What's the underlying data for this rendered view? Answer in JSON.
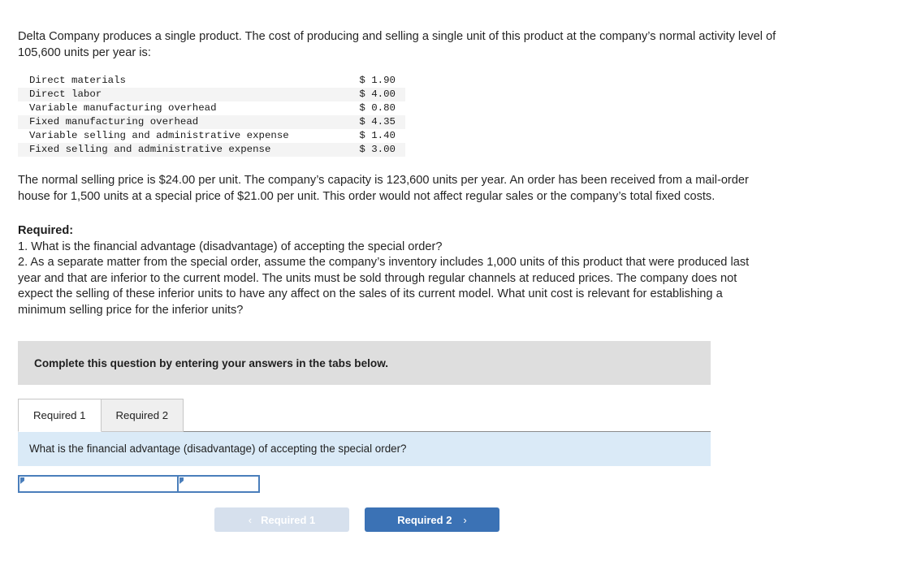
{
  "intro": {
    "paragraph": "Delta Company produces a single product. The cost of producing and selling a single unit of this product at the company’s normal activity level of 105,600 units per year is:"
  },
  "cost_table": {
    "rows": [
      {
        "label": "Direct materials",
        "value": "$ 1.90"
      },
      {
        "label": "Direct labor",
        "value": "$ 4.00"
      },
      {
        "label": "Variable manufacturing overhead",
        "value": "$ 0.80"
      },
      {
        "label": "Fixed manufacturing overhead",
        "value": "$ 4.35"
      },
      {
        "label": "Variable selling and administrative expense",
        "value": "$ 1.40"
      },
      {
        "label": "Fixed selling and administrative expense",
        "value": "$ 3.00"
      }
    ]
  },
  "mid": {
    "paragraph": "The normal selling price is $24.00 per unit. The company’s capacity is 123,600 units per year. An order has been received from a mail-order house for 1,500 units at a special price of $21.00 per unit. This order would not affect regular sales or the company’s total fixed costs."
  },
  "required": {
    "title": "Required:",
    "item1": "1. What is the financial advantage (disadvantage) of accepting the special order?",
    "item2": "2. As a separate matter from the special order, assume the company’s inventory includes 1,000 units of this product that were produced last year and that are inferior to the current model. The units must be sold through regular channels at reduced prices. The company does not expect the selling of these inferior units to have any affect on the sales of its current model. What unit cost is relevant for establishing a minimum selling price for the inferior units?"
  },
  "instruction": {
    "text": "Complete this question by entering your answers in the tabs below."
  },
  "tabs": [
    {
      "label": "Required 1",
      "active": true
    },
    {
      "label": "Required 2",
      "active": false
    }
  ],
  "question": {
    "text": "What is the financial advantage (disadvantage) of accepting the special order?"
  },
  "answer": {
    "cell1_value": "",
    "cell2_value": "",
    "placeholder": ""
  },
  "nav": {
    "prev_label": "Required 1",
    "prev_chevron": "‹",
    "next_label": "Required 2",
    "next_chevron": "›"
  },
  "colors": {
    "instruction_bar": "#dedede",
    "question_bar": "#daeaf7",
    "primary_button": "#3b72b5",
    "disabled_button": "#d6e0ed",
    "input_border": "#4a7ebb",
    "table_stripe": "#f4f4f4"
  }
}
